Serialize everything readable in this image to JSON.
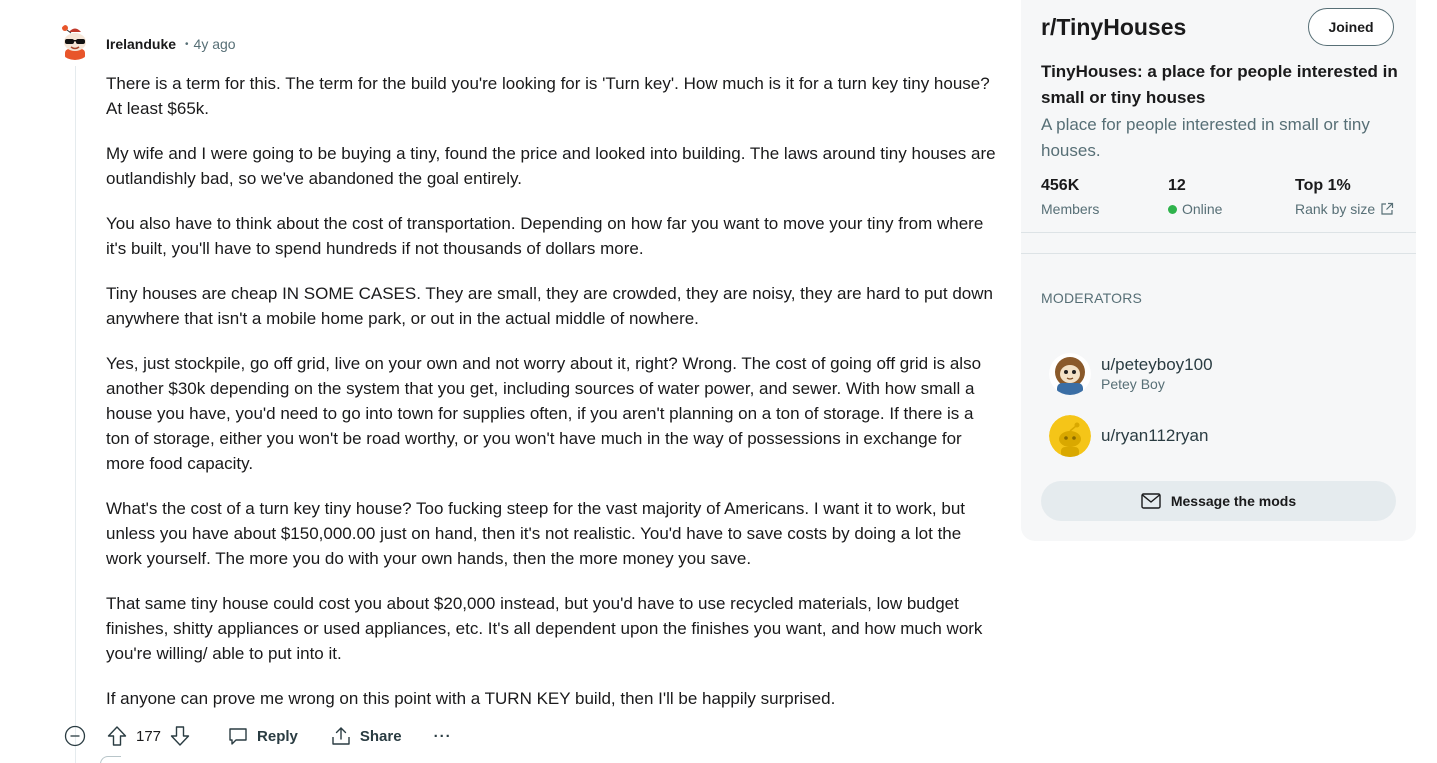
{
  "comment": {
    "author": "Irelanduke",
    "separator": "•",
    "time": "4y ago",
    "paragraphs": [
      "There is a term for this. The term for the build you're looking for is 'Turn key'. How much is it for a turn key tiny house? At least $65k.",
      "My wife and I were going to be buying a tiny, found the price and looked into building. The laws around tiny houses are outlandishly bad, so we've abandoned the goal entirely.",
      "You also have to think about the cost of transportation. Depending on how far you want to move your tiny from where it's built, you'll have to spend hundreds if not thousands of dollars more.",
      "Tiny houses are cheap IN SOME CASES. They are small, they are crowded, they are noisy, they are hard to put down anywhere that isn't a mobile home park, or out in the actual middle of nowhere.",
      "Yes, just stockpile, go off grid, live on your own and not worry about it, right? Wrong. The cost of going off grid is also another $30k depending on the system that you get, including sources of water power, and sewer. With how small a house you have, you'd need to go into town for supplies often, if you aren't planning on a ton of storage. If there is a ton of storage, either you won't be road worthy, or you won't have much in the way of possessions in exchange for more food capacity.",
      "What's the cost of a turn key tiny house? Too fucking steep for the vast majority of Americans. I want it to work, but unless you have about $150,000.00 just on hand, then it's not realistic. You'd have to save costs by doing a lot the work yourself. The more you do with your own hands, then the more money you save.",
      "That same tiny house could cost you about $20,000 instead, but you'd have to use recycled materials, low budget finishes, shitty appliances or used appliances, etc. It's all dependent upon the finishes you want, and how much work you're willing/ able to put into it.",
      "If anyone can prove me wrong on this point with a TURN KEY build, then I'll be happily surprised."
    ],
    "actions": {
      "score": "177",
      "reply_label": "Reply",
      "share_label": "Share",
      "more_label": "···"
    }
  },
  "sidebar": {
    "subreddit": "r/TinyHouses",
    "joined_label": "Joined",
    "title": "TinyHouses: a place for people interested in small or tiny houses",
    "description": "A place for people interested in small or tiny houses.",
    "stats": [
      {
        "value": "456K",
        "label": "Members"
      },
      {
        "value": "12",
        "label": "Online"
      },
      {
        "value": "Top 1%",
        "label": "Rank by size"
      }
    ],
    "moderators_heading": "MODERATORS",
    "moderators": [
      {
        "name": "u/peteyboy100",
        "flair": "Petey Boy"
      },
      {
        "name": "u/ryan112ryan",
        "flair": ""
      }
    ],
    "message_mods_label": "Message the mods"
  },
  "colors": {
    "online": "#2fb34c",
    "muted_text": "#576f76",
    "sidebar_bg": "#f6f7f8",
    "button_bg": "#e5ebee"
  }
}
